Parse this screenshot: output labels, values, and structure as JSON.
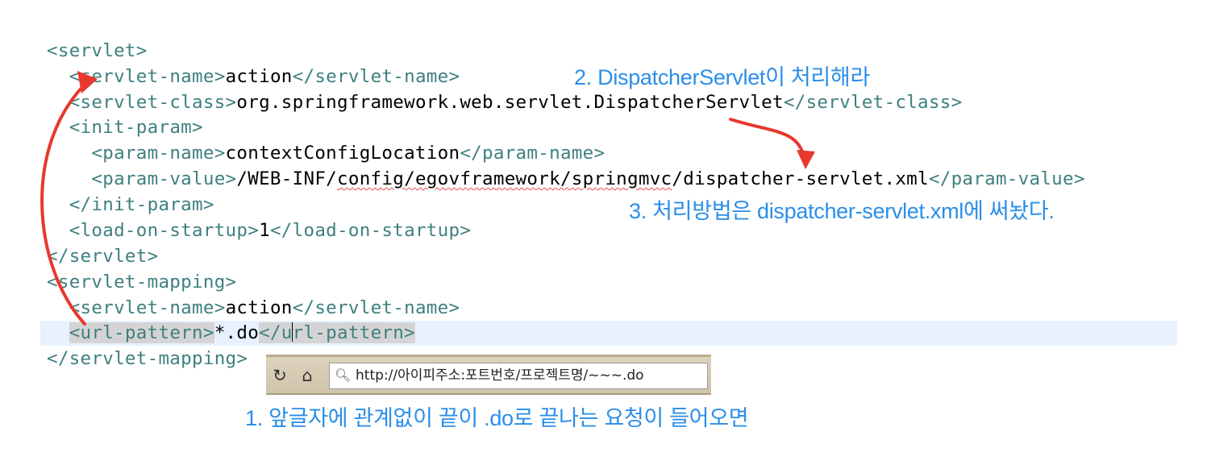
{
  "code": {
    "lines": [
      [
        {
          "t": "<servlet>",
          "c": "tag"
        }
      ],
      [
        {
          "t": "  ",
          "c": "txt"
        },
        {
          "t": "<servlet-name>",
          "c": "tag"
        },
        {
          "t": "action",
          "c": "txt"
        },
        {
          "t": "</servlet-name>",
          "c": "tag"
        }
      ],
      [
        {
          "t": "  ",
          "c": "txt"
        },
        {
          "t": "<servlet-class>",
          "c": "tag"
        },
        {
          "t": "org.springframework.web.servlet.DispatcherServlet",
          "c": "txt"
        },
        {
          "t": "</servlet-class>",
          "c": "tag"
        }
      ],
      [
        {
          "t": "  ",
          "c": "txt"
        },
        {
          "t": "<init-param>",
          "c": "tag"
        }
      ],
      [
        {
          "t": "    ",
          "c": "txt"
        },
        {
          "t": "<param-name>",
          "c": "tag"
        },
        {
          "t": "contextConfigLocation",
          "c": "txt"
        },
        {
          "t": "</param-name>",
          "c": "tag"
        }
      ],
      [
        {
          "t": "    ",
          "c": "txt"
        },
        {
          "t": "<param-value>",
          "c": "tag"
        },
        {
          "t": "/WEB-INF/",
          "c": "txt"
        },
        {
          "t": "config/egovframework/springmvc",
          "c": "txt squig"
        },
        {
          "t": "/dispatcher-servlet.xml",
          "c": "txt"
        },
        {
          "t": "</param-value>",
          "c": "tag"
        }
      ],
      [
        {
          "t": "  ",
          "c": "txt"
        },
        {
          "t": "</init-param>",
          "c": "tag"
        }
      ],
      [
        {
          "t": "  ",
          "c": "txt"
        },
        {
          "t": "<load-on-startup>",
          "c": "tag"
        },
        {
          "t": "1",
          "c": "txt"
        },
        {
          "t": "</load-on-startup>",
          "c": "tag"
        }
      ],
      [
        {
          "t": "</servlet>",
          "c": "tag"
        }
      ],
      [
        {
          "t": "<servlet-mapping>",
          "c": "tag"
        }
      ],
      [
        {
          "t": "  ",
          "c": "txt"
        },
        {
          "t": "<servlet-name>",
          "c": "tag"
        },
        {
          "t": "action",
          "c": "txt"
        },
        {
          "t": "</servlet-name>",
          "c": "tag"
        }
      ],
      [
        {
          "t": "  ",
          "c": "txt"
        },
        {
          "t": "<url-pattern>",
          "c": "tag tagbox"
        },
        {
          "t": "*.do",
          "c": "txt"
        },
        {
          "t": "</u",
          "c": "tag tagbox"
        },
        {
          "t": "",
          "c": "caret"
        },
        {
          "t": "rl-pattern>",
          "c": "tag tagbox"
        }
      ],
      [
        {
          "t": "</servlet-mapping>",
          "c": "tag"
        }
      ]
    ]
  },
  "annotations": {
    "step1": "1. 앞글자에 관계없이 끝이 .do로 끝나는 요청이 들어오면",
    "step2": "2. DispatcherServlet이 처리해라",
    "step3": "3. 처리방법은 dispatcher-servlet.xml에 써놨다."
  },
  "browser": {
    "refresh_icon": "refresh-icon",
    "home_icon": "home-icon",
    "search_icon": "search-icon",
    "url": "http://아이피주소:포트번호/프로젝트명/~~~.do"
  },
  "colors": {
    "tag": "#3f7f7f",
    "annotation": "#2b8ee8",
    "arrow": "#e8382e",
    "current_line": "#e8f2fe"
  }
}
